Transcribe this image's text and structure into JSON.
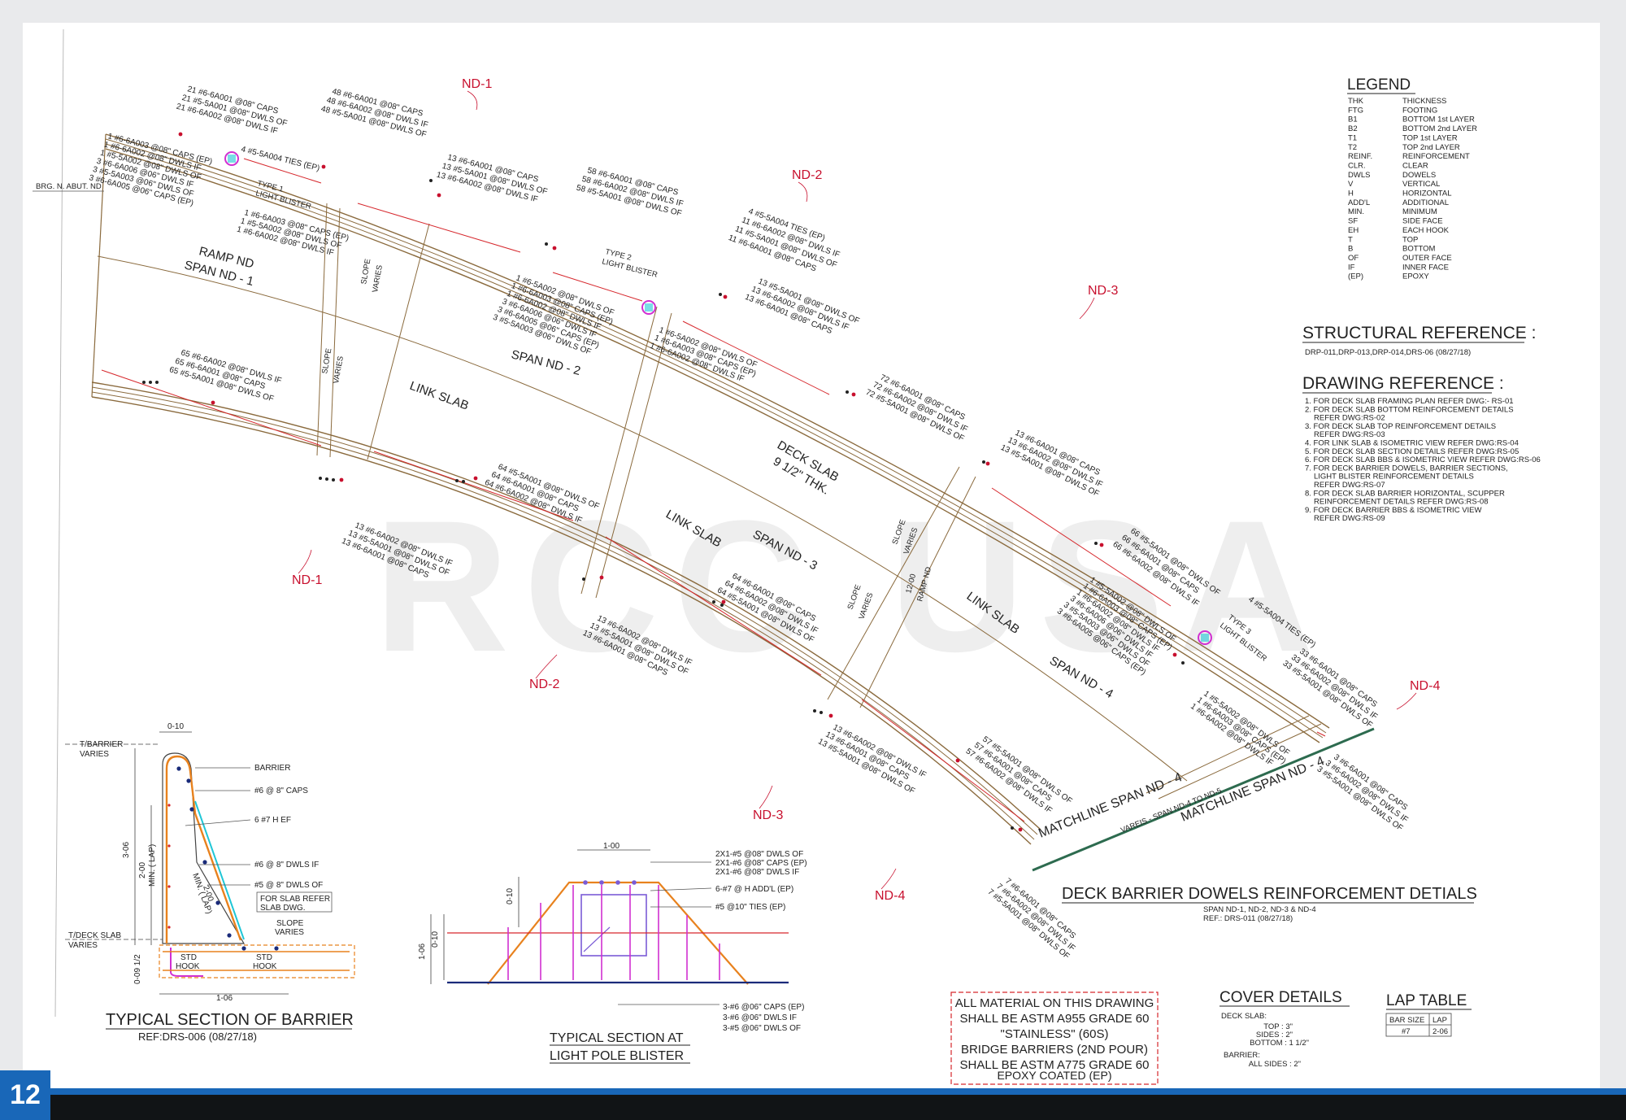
{
  "page_number": "12",
  "watermark": "RCC USA",
  "colors": {
    "footer_bar": "#111416",
    "footer_stripe": "#1967b8",
    "nd_marker": "#c8102e",
    "rebar_orange": "#e8821e",
    "rebar_cyan": "#1fc6d6",
    "rebar_magenta": "#d12fd1"
  },
  "nd_markers": [
    "ND-1",
    "ND-2",
    "ND-3",
    "ND-1",
    "ND-2",
    "ND-3",
    "ND-4",
    "ND-4"
  ],
  "legend": {
    "title": "LEGEND",
    "items": [
      {
        "abbr": "THK",
        "meaning": "THICKNESS"
      },
      {
        "abbr": "FTG",
        "meaning": "FOOTING"
      },
      {
        "abbr": "B1",
        "meaning": "BOTTOM 1st LAYER"
      },
      {
        "abbr": "B2",
        "meaning": "BOTTOM 2nd LAYER"
      },
      {
        "abbr": "T1",
        "meaning": "TOP 1st LAYER"
      },
      {
        "abbr": "T2",
        "meaning": "TOP 2nd LAYER"
      },
      {
        "abbr": "REINF.",
        "meaning": "REINFORCEMENT"
      },
      {
        "abbr": "CLR.",
        "meaning": "CLEAR"
      },
      {
        "abbr": "DWLS",
        "meaning": "DOWELS"
      },
      {
        "abbr": "V",
        "meaning": "VERTICAL"
      },
      {
        "abbr": "H",
        "meaning": "HORIZONTAL"
      },
      {
        "abbr": "ADD'L",
        "meaning": "ADDITIONAL"
      },
      {
        "abbr": "MIN.",
        "meaning": "MINIMUM"
      },
      {
        "abbr": "SF",
        "meaning": "SIDE FACE"
      },
      {
        "abbr": "EH",
        "meaning": "EACH HOOK"
      },
      {
        "abbr": "T",
        "meaning": "TOP"
      },
      {
        "abbr": "B",
        "meaning": "BOTTOM"
      },
      {
        "abbr": "OF",
        "meaning": "OUTER FACE"
      },
      {
        "abbr": "IF",
        "meaning": "INNER FACE"
      },
      {
        "abbr": "(EP)",
        "meaning": "EPOXY"
      }
    ]
  },
  "structural_reference": {
    "title": "STRUCTURAL REFERENCE :",
    "text": "DRP-011,DRP-013,DRP-014,DRS-06 (08/27/18)"
  },
  "drawing_reference": {
    "title": "DRAWING REFERENCE :",
    "lines": [
      "1. FOR DECK SLAB FRAMING PLAN REFER DWG:- RS-01",
      "2. FOR DECK SLAB BOTTOM REINFORCEMENT DETAILS",
      "REFER DWG:RS-02",
      "3. FOR DECK SLAB TOP REINFORCEMENT DETAILS",
      "REFER DWG:RS-03",
      "4. FOR LINK SLAB & ISOMETRIC VIEW REFER DWG:RS-04",
      "5. FOR DECK SLAB SECTION DETAILS REFER DWG:RS-05",
      "6. FOR DECK SLAB BBS & ISOMETRIC VIEW REFER DWG:RS-06",
      "7. FOR DECK BARRIER DOWELS, BARRIER SECTIONS,",
      "LIGHT BLISTER  REINFORCEMENT DETAILS",
      "REFER DWG:RS-07",
      "8. FOR DECK SLAB BARRIER HORIZONTAL, SCUPPER",
      "REINFORCEMENT DETAILS REFER DWG:RS-08",
      "9. FOR DECK BARRIER BBS & ISOMETRIC VIEW",
      "REFER DWG:RS-09"
    ]
  },
  "plan_labels": {
    "ramp_nd": "RAMP ND",
    "span_nd_1": "SPAN ND - 1",
    "span_nd_2": "SPAN ND - 2",
    "span_nd_3": "SPAN ND - 3",
    "span_nd_4": "SPAN ND - 4",
    "link_slab": "LINK SLAB",
    "deck_slab": "DECK SLAB",
    "deck_thk": "9 1/2\" THK.",
    "slope": "SLOPE",
    "varies": "VARIES",
    "brg_abut": "BRG. N. ABUT. ND",
    "type1": "TYPE 1",
    "type2": "TYPE 2",
    "type3": "TYPE 3",
    "light_blister": "LIGHT BLISTER",
    "matchline": "MATCHLINE SPAN ND - 4",
    "vareis": "VAREIS - SPAN ND-4 TO ND-5",
    "ramp_nd_small": "RAMP ND",
    "ramp_nd_dim": "12-00"
  },
  "rebar_groups": [
    [
      "21 #6-6A001 @08\" CAPS",
      "21 #5-5A001 @08\" DWLS OF",
      "21 #6-6A002 @08\" DWLS IF"
    ],
    [
      "48 #6-6A001 @08\" CAPS",
      "48 #6-6A002 @08\" DWLS IF",
      "48 #5-5A001 @08\" DWLS OF"
    ],
    [
      "1 #6-6A003 @08\" CAPS (EP)",
      "1 #6-6A002 @08\" DWLS IF",
      "1 #5-5A002 @08\" DWLS OF",
      "3 #6-6A006 @06\" DWLS IF",
      "3 #5-5A003 @06\" DWLS OF",
      "3 #6-6A005 @06\" CAPS (EP)"
    ],
    [
      "4 #5-5A004  TIES (EP)"
    ],
    [
      "1 #6-6A003 @08\" CAPS (EP)",
      "1 #5-5A002 @08\" DWLS OF",
      "1 #6-6A002 @08\" DWLS IF"
    ],
    [
      "13 #6-6A001 @08\" CAPS",
      "13 #5-5A001 @08\" DWLS OF",
      "13 #6-6A002 @08\" DWLS IF"
    ],
    [
      "58 #6-6A001 @08\" CAPS",
      "58 #6-6A002 @08\" DWLS IF",
      "58 #5-5A001 @08\" DWLS OF"
    ],
    [
      "4 #5-5A004  TIES (EP)",
      "11 #6-6A002 @08\" DWLS IF",
      "11 #5-5A001 @08\" DWLS OF",
      "11 #6-6A001 @08\" CAPS"
    ],
    [
      "1 #6-5A002 @08\" DWLS OF",
      "1 #6-6A003 @08\" CAPS (EP)",
      "1 #6-6A002 @08\" DWLS IF",
      "3 #6-6A006 @06\" DWLS IF",
      "3 #6-6A005 @06\" CAPS (EP)",
      "3 #5-5A003 @06\" DWLS OF"
    ],
    [
      "13 #5-5A001 @08\" DWLS OF",
      "13 #6-6A002 @08\" DWLS IF",
      "13 #6-6A001 @08\" CAPS"
    ],
    [
      "1 #6-5A002 @08\" DWLS OF",
      "1 #6-6A003 @08\" CAPS (EP)",
      "1 #6-6A002 @08\" DWLS IF"
    ],
    [
      "65 #6-6A002 @08\" DWLS IF",
      "65 #6-6A001 @08\" CAPS",
      "65 #5-5A001 @08\" DWLS OF"
    ],
    [
      "72 #6-6A001 @08\" CAPS",
      "72 #6-6A002 @08\" DWLS IF",
      "72 #5-5A001 @08\" DWLS OF"
    ],
    [
      "13 #6-6A001 @08\" CAPS",
      "13 #6-6A002 @08\" DWLS IF",
      "13 #5-5A001 @08\" DWLS OF"
    ],
    [
      "64 #5-5A001 @08\" DWLS OF",
      "64 #6-6A001 @08\" CAPS",
      "64 #6-6A002 @08\" DWLS IF"
    ],
    [
      "13 #6-6A002 @08\" DWLS IF",
      "13 #5-5A001 @08\" DWLS OF",
      "13 #6-6A001 @08\" CAPS"
    ],
    [
      "66 #5-5A001 @08\" DWLS OF",
      "66 #6-6A001 @08\" CAPS",
      "66 #6-6A002 @08\" DWLS IF"
    ],
    [
      "1 #5-5A002 @08\" DWLS OF",
      "1 #6-6A003 @08\" CAPS (EP)",
      "1 #6-6A002 @08\" DWLS IF",
      "3 #6-6A006 @06\" DWLS IF",
      "3 #5-5A003 @06\" DWLS OF",
      "3 #6-6A005 @06\" CAPS (EP)"
    ],
    [
      "4 #5-5A004  TIES (EP)"
    ],
    [
      "64 #6-6A001 @08\" CAPS",
      "64 #6-6A002 @08\" DWLS IF",
      "64 #5-5A001 @08\" DWLS OF"
    ],
    [
      "13 #6-6A002 @08\" DWLS IF",
      "13 #5-5A001 @08\" DWLS OF",
      "13 #6-6A001 @08\" CAPS"
    ],
    [
      "33 #6-6A001 @08\" CAPS",
      "33 #6-6A002 @08\" DWLS IF",
      "33 #5-5A001 @08\" DWLS OF"
    ],
    [
      "1 #5-5A002 @08\" DWLS OF",
      "1 #6-6A003 @08\" CAPS (EP)",
      "1 #6-6A002 @08\" DWLS IF"
    ],
    [
      "13 #6-6A002 @08\" DWLS IF",
      "13 #6-6A001 @08\" CAPS",
      "13 #5-5A001 @08\" DWLS OF"
    ],
    [
      "57 #5-5A001 @08\" DWLS OF",
      "57 #6-6A001 @08\" CAPS",
      "57 #6-6A002 @08\" DWLS IF"
    ],
    [
      "7 #6-6A001 @08\" CAPS",
      "7 #6-6A002 @08\" DWLS IF",
      "7 #5-5A001 @08\" DWLS OF"
    ],
    [
      "3 #6-6A001 @08\" CAPS",
      "3 #6-6A002 @08\" DWLS IF",
      "3 #5-5A001 @08\" DWLS OF"
    ]
  ],
  "main_title": {
    "title": "DECK BARRIER DOWELS REINFORCEMENT DETIALS",
    "sub1": "SPAN ND-1, ND-2, ND-3 & ND-4",
    "sub2": "REF.: DRS-011 (08/27/18)"
  },
  "barrier_section": {
    "title": "TYPICAL SECTION OF BARRIER",
    "ref": "REF:DRS-006 (08/27/18)",
    "callouts": [
      "BARRIER",
      "#6 @ 8\" CAPS",
      "6 #7 H EF",
      "#6 @ 8\" DWLS IF",
      "#5 @ 8\" DWLS OF"
    ],
    "slab_note": [
      "FOR SLAB REFER",
      "SLAB DWG."
    ],
    "slope": "SLOPE",
    "varies": "VARIES",
    "t_barrier": "T/BARRIER",
    "t_deck": "T/DECK SLAB",
    "std_hook": [
      "STD",
      "HOOK"
    ],
    "dims": {
      "top": "0-10",
      "bottom": "1-06",
      "left": "3-06",
      "min_lap": "2-00",
      "min_lap2": "MIN. ( LAP)",
      "base": "0-09 1/2",
      "diag": "2-00",
      "diag2": "MIN. ( LAP)"
    }
  },
  "pole_blister": {
    "title1": "TYPICAL SECTION AT",
    "title2": "LIGHT POLE BLISTER",
    "callouts_top": [
      "2X1-#5 @08\" DWLS OF",
      "2X1-#6 @08\" CAPS (EP)",
      "2X1-#6 @08\" DWLS IF"
    ],
    "callouts_mid": [
      "6-#7 @ H ADD'L (EP)",
      "#5 @10\" TIES  (EP)"
    ],
    "callouts_bottom": [
      "3-#6 @06\" CAPS (EP)",
      "3-#6 @06\" DWLS IF",
      "3-#5 @06\" DWLS OF"
    ],
    "dims": {
      "top": "1-00",
      "left1": "0-10",
      "left2": "0-10",
      "left3": "1-06"
    }
  },
  "material_note": [
    "ALL MATERIAL ON THIS DRAWING",
    "SHALL BE ASTM A955 GRADE 60",
    "\"STAINLESS\" (60S)",
    "BRIDGE BARRIERS (2ND POUR)",
    "SHALL BE ASTM A775 GRADE 60",
    "EPOXY COATED (EP)"
  ],
  "cover_details": {
    "title": "COVER DETAILS",
    "deck_slab": "DECK SLAB:",
    "top": "TOP : 3\"",
    "sides": "SIDES : 2\"",
    "bottom": "BOTTOM : 1 1/2\"",
    "barrier": "BARRIER:",
    "all_sides": "ALL SIDES : 2\""
  },
  "lap_table": {
    "title": "LAP TABLE",
    "headers": [
      "BAR SIZE",
      "LAP"
    ],
    "rows": [
      [
        "#7",
        "2-06"
      ]
    ]
  }
}
